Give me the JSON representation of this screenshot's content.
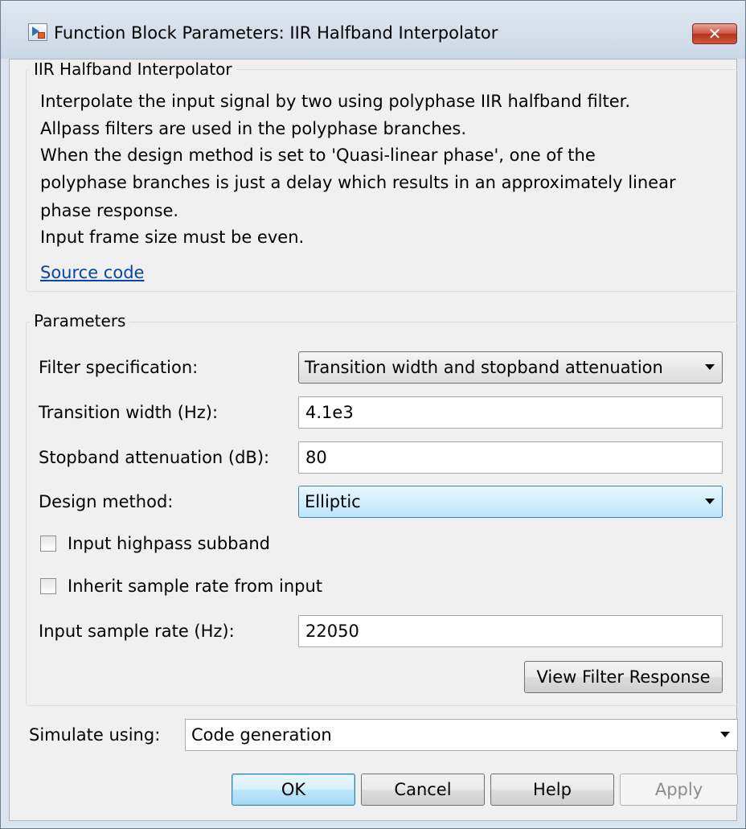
{
  "window": {
    "title": "Function Block Parameters: IIR Halfband Interpolator",
    "close_label": "✕"
  },
  "description": {
    "group_title": "IIR Halfband Interpolator",
    "lines": [
      "Interpolate the input signal by two using polyphase IIR halfband filter.",
      "Allpass filters are used in the polyphase branches.",
      "When the design method is set to 'Quasi-linear phase', one of the",
      "polyphase branches is just a delay which results in an approximately linear",
      "phase response.",
      "Input frame size must be even."
    ],
    "link_text": "Source code"
  },
  "parameters": {
    "group_title": "Parameters",
    "filter_specification": {
      "label": "Filter specification:",
      "value": "Transition width and stopband attenuation"
    },
    "transition_width": {
      "label": "Transition width (Hz):",
      "value": "4.1e3"
    },
    "stopband_attenuation": {
      "label": "Stopband attenuation (dB):",
      "value": "80"
    },
    "design_method": {
      "label": "Design method:",
      "value": "Elliptic"
    },
    "input_highpass_subband": {
      "label": "Input highpass subband",
      "checked": false
    },
    "inherit_sample_rate": {
      "label": "Inherit sample rate from input",
      "checked": false
    },
    "input_sample_rate": {
      "label": "Input sample rate (Hz):",
      "value": "22050"
    },
    "view_filter_response_label": "View Filter Response"
  },
  "simulate": {
    "label": "Simulate using:",
    "value": "Code generation"
  },
  "buttons": {
    "ok": "OK",
    "cancel": "Cancel",
    "help": "Help",
    "apply": "Apply"
  }
}
